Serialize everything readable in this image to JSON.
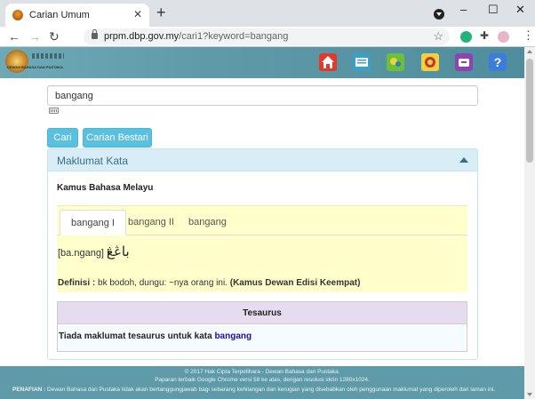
{
  "browser": {
    "tab_title": "Carian Umum",
    "url_host": "prpm.dbp.gov.my",
    "url_path": "/cari1?keyword=bangang",
    "new_tab": "+",
    "tab_close": "✕",
    "window_min": "–",
    "window_max": "☐",
    "window_close": "✕",
    "back": "←",
    "forward": "→",
    "reload": "↻",
    "star": "☆",
    "menu": "⋮"
  },
  "site": {
    "logo_text": "DEWAN BAHASA DAN PUSTAKA",
    "header_icons": [
      "home-icon",
      "dictionary-icon",
      "map-icon",
      "emblem-icon",
      "mailbox-icon",
      "help-icon"
    ],
    "colors": {
      "header": "#5f9aa8",
      "button": "#5bc0de",
      "panel_heading": "#d9edf7",
      "result_bg": "#ffffcc",
      "thesaurus_head": "#e6dcf0"
    }
  },
  "search": {
    "value": "bangang",
    "btn_search": "Cari",
    "btn_smart": "Carian Bestari"
  },
  "panel": {
    "title": "Maklumat Kata",
    "dictionary": "Kamus Bahasa Melayu",
    "tabs": [
      {
        "label": "bangang I"
      },
      {
        "label": "bangang II"
      },
      {
        "label": "bangang"
      }
    ],
    "pronunciation": "[ba.ngang] |",
    "jawi": "باڠڠ",
    "definition_label": "Definisi :",
    "definition_text": " bk bodoh, dungu: ~nya orang ini.",
    "definition_source": "(Kamus Dewan Edisi Keempat)"
  },
  "thesaurus": {
    "title": "Tesaurus",
    "text": "Tiada maklumat tesaurus untuk kata",
    "word": "bangang"
  },
  "footer": {
    "copyright": "© 2017 Hak Cipta Terpelihara - Dewan Bahasa dan Pustaka.",
    "browser_note": "Paparan terbaik Google Chrome versi 58 ke atas, dengan resolusi skrin 1280x1024.",
    "disclaimer_label": "PENAFIAN :",
    "disclaimer": " Dewan Bahasa dan Pustaka tidak akan bertanggungjawab bagi sebarang kehilangan dan kerugian yang disebabkan oleh penggunaan maklumat yang diperoleh dari laman ini."
  }
}
